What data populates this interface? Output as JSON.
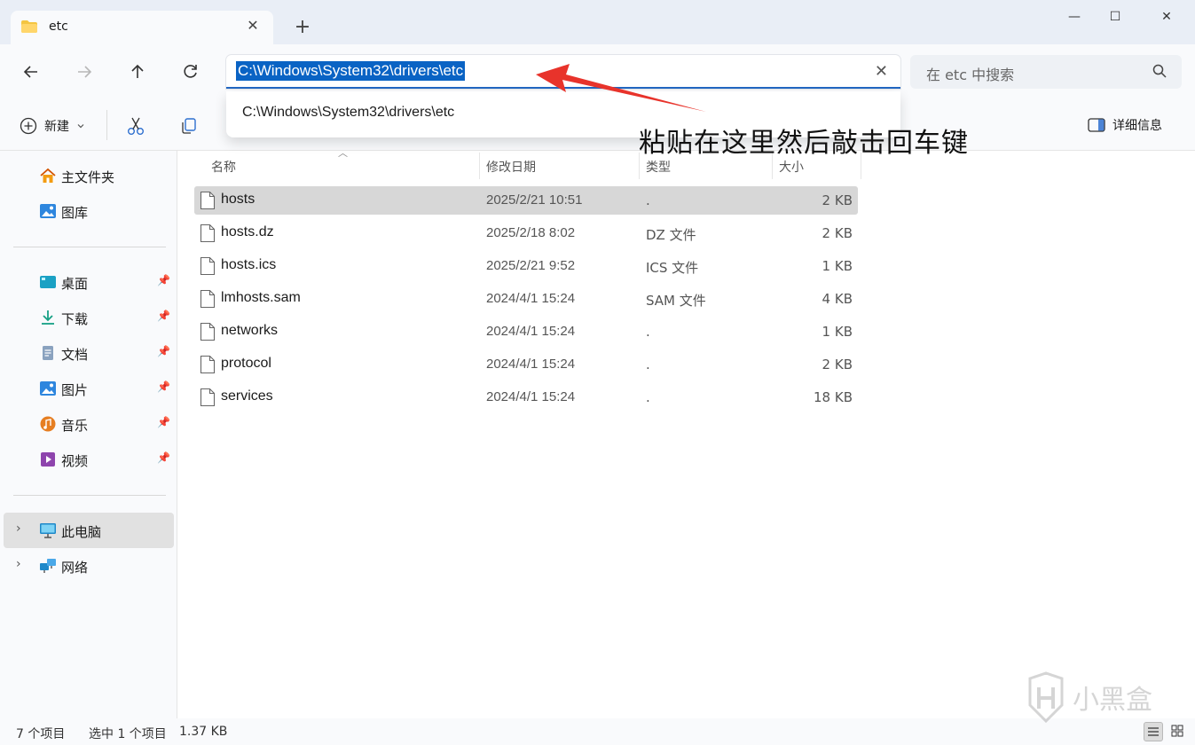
{
  "window": {
    "tab_title": "etc",
    "new_tab_glyph": "+",
    "tab_close_glyph": "✕",
    "minimize_glyph": "—",
    "maximize_glyph": "☐",
    "close_glyph": "✕"
  },
  "nav": {
    "address_path": "C:\\Windows\\System32\\drivers\\etc",
    "address_clear_glyph": "✕",
    "search_placeholder": "在 etc 中搜索",
    "suggestion": "C:\\Windows\\System32\\drivers\\etc"
  },
  "commands": {
    "new_label": "新建",
    "details_label": "详细信息"
  },
  "sidebar": {
    "quick": [
      {
        "label": "主文件夹",
        "icon": "home-icon"
      },
      {
        "label": "图库",
        "icon": "gallery-icon"
      }
    ],
    "pinned": [
      {
        "label": "桌面",
        "icon": "desktop-icon"
      },
      {
        "label": "下载",
        "icon": "download-icon"
      },
      {
        "label": "文档",
        "icon": "document-icon"
      },
      {
        "label": "图片",
        "icon": "pictures-icon"
      },
      {
        "label": "音乐",
        "icon": "music-icon"
      },
      {
        "label": "视频",
        "icon": "video-icon"
      }
    ],
    "devices": [
      {
        "label": "此电脑",
        "icon": "this-pc-icon",
        "selected": true
      },
      {
        "label": "网络",
        "icon": "network-icon",
        "selected": false
      }
    ]
  },
  "columns": {
    "name": "名称",
    "modified": "修改日期",
    "type": "类型",
    "size": "大小"
  },
  "files": [
    {
      "name": "hosts",
      "modified": "2025/2/21 10:51",
      "type": ".",
      "size": "2 KB",
      "selected": true
    },
    {
      "name": "hosts.dz",
      "modified": "2025/2/18 8:02",
      "type": "DZ 文件",
      "size": "2 KB",
      "selected": false
    },
    {
      "name": "hosts.ics",
      "modified": "2025/2/21 9:52",
      "type": "ICS 文件",
      "size": "1 KB",
      "selected": false
    },
    {
      "name": "lmhosts.sam",
      "modified": "2024/4/1 15:24",
      "type": "SAM 文件",
      "size": "4 KB",
      "selected": false
    },
    {
      "name": "networks",
      "modified": "2024/4/1 15:24",
      "type": ".",
      "size": "1 KB",
      "selected": false
    },
    {
      "name": "protocol",
      "modified": "2024/4/1 15:24",
      "type": ".",
      "size": "2 KB",
      "selected": false
    },
    {
      "name": "services",
      "modified": "2024/4/1 15:24",
      "type": ".",
      "size": "18 KB",
      "selected": false
    }
  ],
  "status": {
    "item_count": "7 个项目",
    "selection": "选中 1 个项目",
    "selection_size": "1.37 KB"
  },
  "annotation": {
    "text": "粘贴在这里然后敲击回车键",
    "arrow_color": "#e8332b"
  },
  "colors": {
    "accent": "#0a63c4",
    "folder": "#f4c542"
  }
}
